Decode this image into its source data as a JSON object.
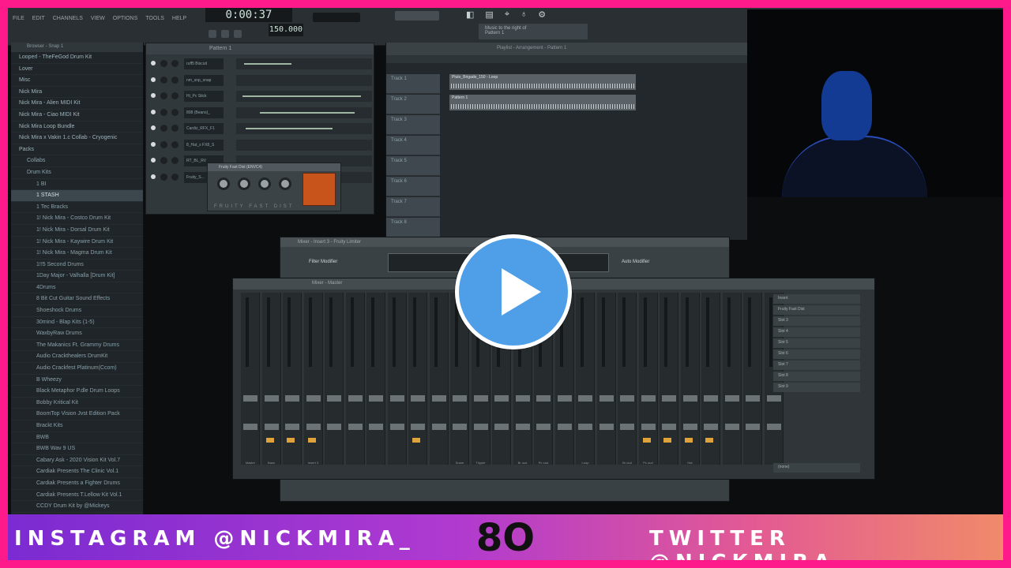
{
  "colors": {
    "border": "#ff1a8c",
    "play_button": "#4f9ee8",
    "banner_start": "#7a2bd1",
    "banner_end": "#f08a6a"
  },
  "toolbar": {
    "menu": [
      "FILE",
      "EDIT",
      "CHANNELS",
      "VIEW",
      "OPTIONS",
      "TOOLS",
      "HELP"
    ],
    "time_display": "0:00:37",
    "tempo": "150.000",
    "hint_lines": [
      "Music to the right of",
      "Pattern 1"
    ],
    "icons": [
      "transport-icon",
      "snap-icon",
      "pin-icon",
      "mic-icon",
      "settings-icon"
    ]
  },
  "browser": {
    "header": "Browser - Snap 1",
    "items": [
      {
        "label": "Looperl - TheFeGod Drum Kit",
        "level": 0
      },
      {
        "label": "Lover",
        "level": 0
      },
      {
        "label": "Misc",
        "level": 0
      },
      {
        "label": "Nick Mira",
        "level": 0
      },
      {
        "label": "Nick Mira - Alien MIDI Kit",
        "level": 0
      },
      {
        "label": "Nick Mira - Ciao MIDI Kit",
        "level": 0
      },
      {
        "label": "Nick Mira Loop Bundle",
        "level": 0
      },
      {
        "label": "Nick Mira x Vakin 1.c Collab - Cryogenic",
        "level": 0
      },
      {
        "label": "Packs",
        "level": 0
      },
      {
        "label": "Collabs",
        "level": 1
      },
      {
        "label": "Drum Kits",
        "level": 1
      },
      {
        "label": "1 BI",
        "level": 2
      },
      {
        "label": "1 STASH",
        "level": 2,
        "selected": true
      },
      {
        "label": "1 Tec Bracks",
        "level": 2
      },
      {
        "label": "1! Nick Mira - Costco Drum Kit",
        "level": 2
      },
      {
        "label": "1! Nick Mira - Dorsal Drum Kit",
        "level": 2
      },
      {
        "label": "1! Nick Mira - Kaywire Drum Kit",
        "level": 2
      },
      {
        "label": "1! Nick Mira - Magma Drum Kit",
        "level": 2
      },
      {
        "label": "1!!5 Second Drums",
        "level": 2
      },
      {
        "label": "1Day Major - Valhalla [Drum Kit]",
        "level": 2
      },
      {
        "label": "4Drums",
        "level": 2
      },
      {
        "label": "8 Bit Cut Guitar Sound Effects",
        "level": 2
      },
      {
        "label": "Shoeshock Drums",
        "level": 2
      },
      {
        "label": "30mind - Blap Kits (1-5)",
        "level": 2
      },
      {
        "label": "WaxbyRaw Drums",
        "level": 2
      },
      {
        "label": "The Makanics Ft. Grammy Drums",
        "level": 2
      },
      {
        "label": "Audio Crackthealers DrumKit",
        "level": 2
      },
      {
        "label": "Audio Crackfest Platinum(Ccom)",
        "level": 2
      },
      {
        "label": "B Wheezy",
        "level": 2
      },
      {
        "label": "Black Metaphor P.dle Drum Loops",
        "level": 2
      },
      {
        "label": "Bobby Kritical Kit",
        "level": 2
      },
      {
        "label": "BoomTop Vision Jvst Edition Pack",
        "level": 2
      },
      {
        "label": "Brackt Kits",
        "level": 2
      },
      {
        "label": "BWB",
        "level": 2
      },
      {
        "label": "BWB Wav 9 US",
        "level": 2
      },
      {
        "label": "Cabary Ask - 2020 Vision Kit Vol.7",
        "level": 2
      },
      {
        "label": "Cardiak Presents The Clinic Vol.1",
        "level": 2
      },
      {
        "label": "Cardiak Presents a Fighter Drums",
        "level": 2
      },
      {
        "label": "Cardiak Presents T.Lellow Kit Vol.1",
        "level": 2
      },
      {
        "label": "CCDY Drum Kit by @Mickeys",
        "level": 2
      }
    ]
  },
  "rack": {
    "header": "Pattern 1",
    "channels": [
      "ruff5 Biscuit",
      "nm_snp_snap",
      "Hi_Pc Stick",
      "808 (Beans)_",
      "Cardiz_RFX_F1",
      "8_Hat_s FX8_S",
      "RT_BL_RV",
      "Fruity_S..."
    ]
  },
  "plugin": {
    "title": "Fruity Fast Dist (ENVC4)",
    "footer": "FRUITY FAST DIST"
  },
  "playlist": {
    "header": "Playlist - Arrangement - Pattern 1",
    "tracks": [
      "Track 1",
      "Track 2",
      "Track 3",
      "Track 4",
      "Track 5",
      "Track 6",
      "Track 7",
      "Track 8"
    ],
    "clips": [
      "Pluto_Brigade_150 - Loop",
      "Pattern 1"
    ]
  },
  "mixer_back": {
    "title": "Mixer - Insert 3 - Fruity Limiter",
    "left_label": "Filter Modifier",
    "right_label": "Auto Modifier"
  },
  "mixer": {
    "title": "Mixer - Master",
    "strip_labels": [
      "Master",
      "Bass",
      "",
      "Insert 3",
      "",
      "",
      "",
      "",
      "",
      "",
      "Snare",
      "Tripple",
      "",
      "Br oud",
      "Pc oud",
      "",
      "Loop",
      "",
      "Br oud",
      "Pc oud",
      "",
      "Hat",
      "",
      "",
      "",
      ""
    ],
    "slots": [
      "Insert",
      "Fruity Fast Dist",
      "Slot 3",
      "Slot 4",
      "Slot 5",
      "Slot 6",
      "Slot 7",
      "Slot 8",
      "Slot 9"
    ],
    "bottom_label": "(none)"
  },
  "banner": {
    "left": "INSTAGRAM @NICKMIRA_",
    "right": "TWITTER @NICKMIRA_",
    "logo": "8O"
  }
}
